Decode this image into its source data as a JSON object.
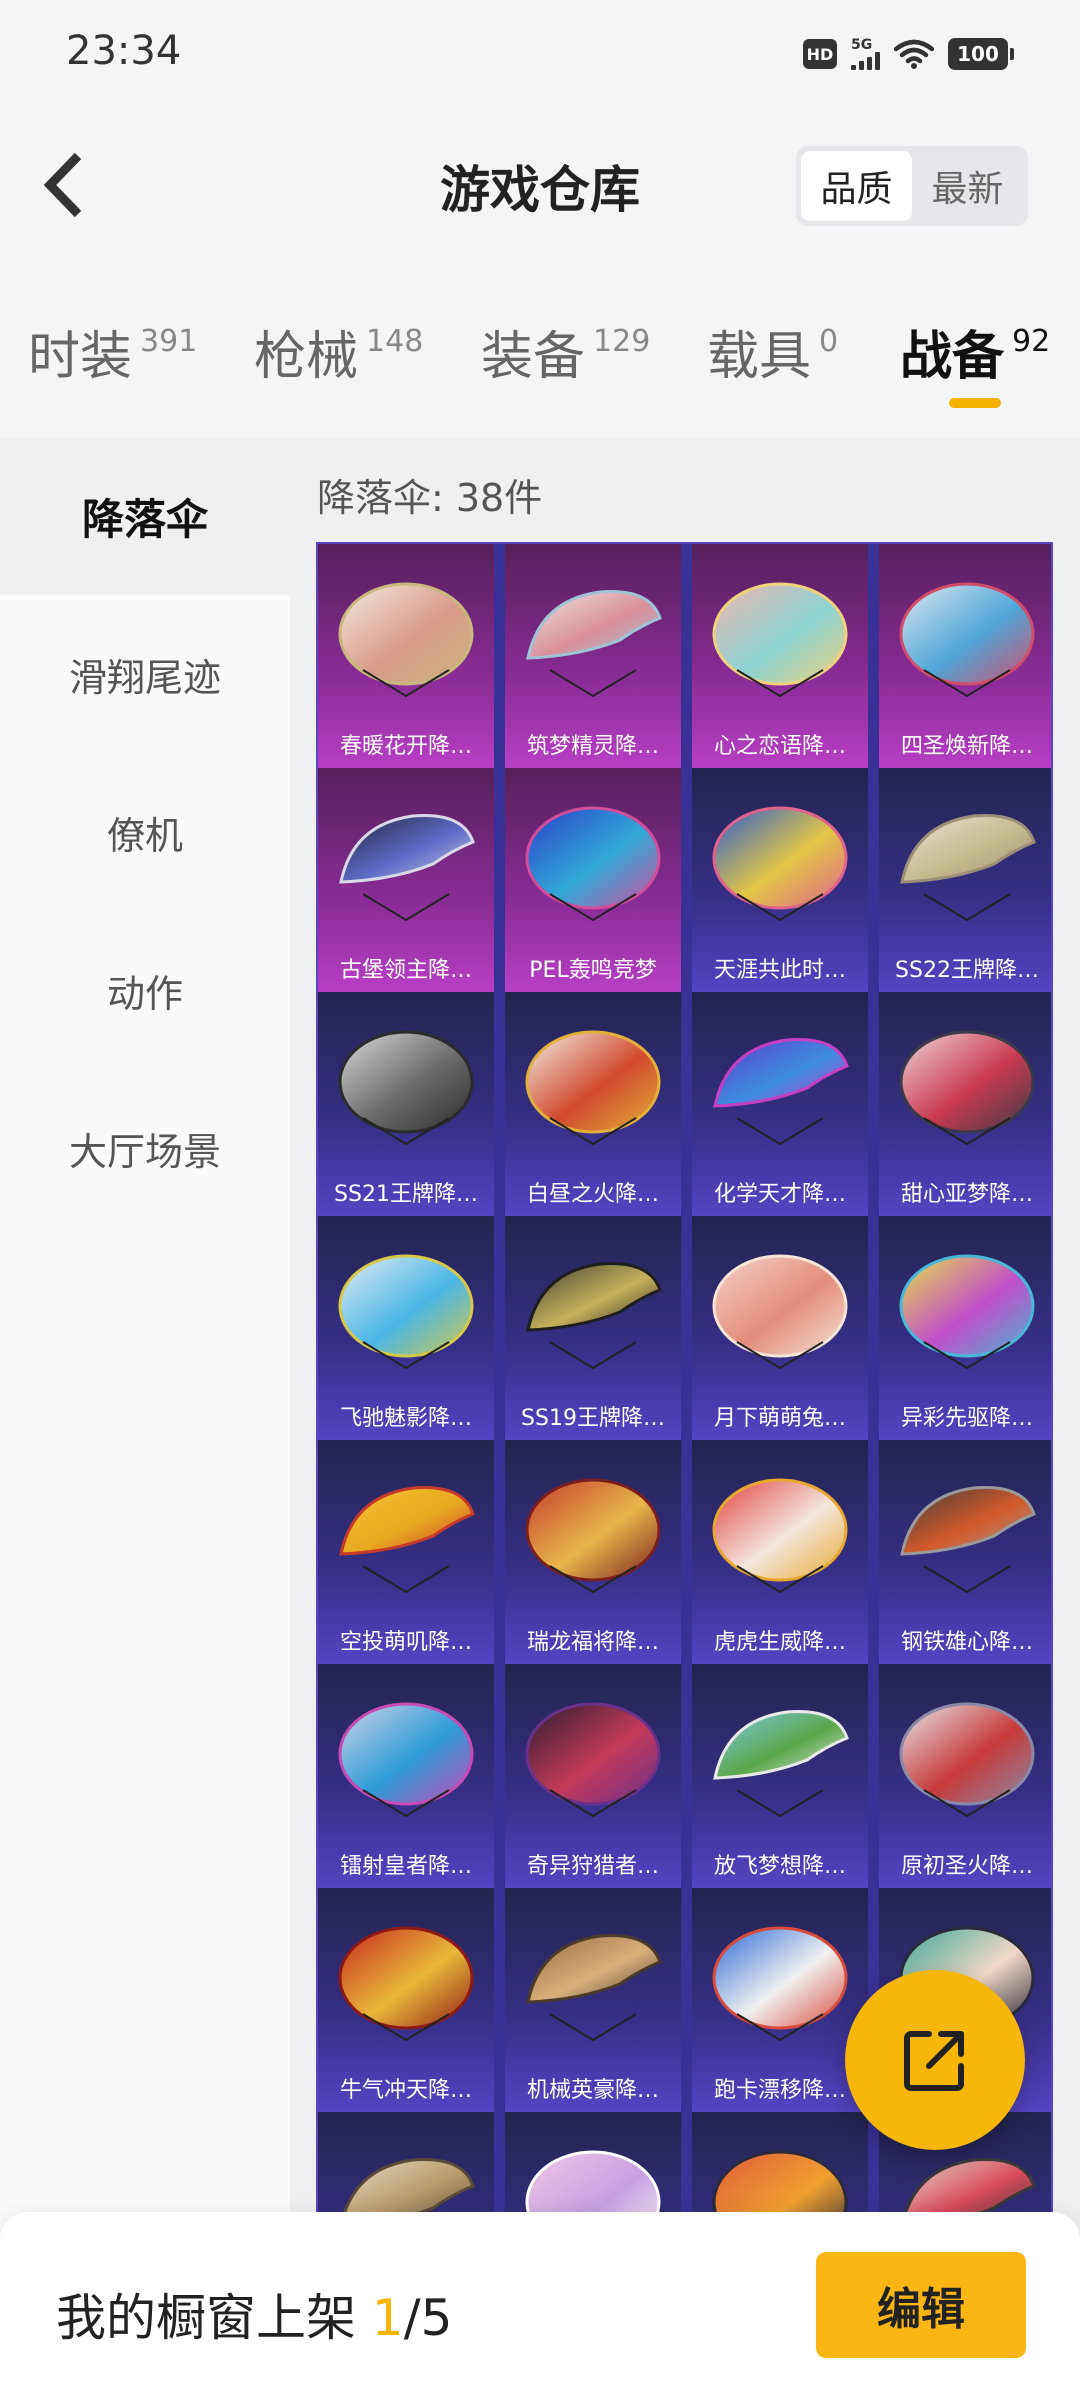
{
  "status_bar": {
    "time": "23:34",
    "hd": "HD",
    "network": "5G",
    "battery": "100"
  },
  "header": {
    "title": "游戏仓库",
    "sort_options": [
      "品质",
      "最新"
    ],
    "sort_selected": "品质"
  },
  "category_tabs": [
    {
      "label": "时装",
      "count": "391"
    },
    {
      "label": "枪械",
      "count": "148"
    },
    {
      "label": "装备",
      "count": "129"
    },
    {
      "label": "载具",
      "count": "0"
    },
    {
      "label": "战备",
      "count": "92",
      "active": true
    }
  ],
  "sidebar": {
    "items": [
      "降落伞",
      "滑翔尾迹",
      "僚机",
      "动作",
      "大厅场景"
    ],
    "selected": "降落伞"
  },
  "content": {
    "count_text": "降落伞: 38件",
    "items": [
      {
        "name": "春暖花开降…",
        "tier": "rare",
        "colors": [
          "#f3ecdf",
          "#d99a8a",
          "#c9b77d"
        ]
      },
      {
        "name": "筑梦精灵降…",
        "tier": "rare",
        "colors": [
          "#efe6e0",
          "#d98f9b",
          "#9fc4d8"
        ]
      },
      {
        "name": "心之恋语降…",
        "tier": "rare",
        "colors": [
          "#f1b7b0",
          "#8bd3d2",
          "#f0d27c"
        ]
      },
      {
        "name": "四圣焕新降…",
        "tier": "rare",
        "colors": [
          "#dfe8ef",
          "#4fa6d8",
          "#d24d6a"
        ]
      },
      {
        "name": "古堡领主降…",
        "tier": "rare",
        "colors": [
          "#23233a",
          "#5c6bc8",
          "#d8d8e8"
        ]
      },
      {
        "name": "PEL轰鸣竞梦",
        "tier": "rare",
        "colors": [
          "#2a3ec8",
          "#31a9d8",
          "#d24d9c"
        ]
      },
      {
        "name": "天涯共此时…",
        "tier": "epic",
        "colors": [
          "#2c5bd0",
          "#e2c646",
          "#e0638c"
        ]
      },
      {
        "name": "SS22王牌降…",
        "tier": "epic",
        "colors": [
          "#e7e2d6",
          "#c7b98e",
          "#9c8f78"
        ]
      },
      {
        "name": "SS21王牌降…",
        "tier": "epic",
        "colors": [
          "#d9d9d9",
          "#6a6a6a",
          "#2b2b2b"
        ]
      },
      {
        "name": "白昼之火降…",
        "tier": "epic",
        "colors": [
          "#f2eee6",
          "#d14a2e",
          "#e3b03a"
        ]
      },
      {
        "name": "化学天才降…",
        "tier": "epic",
        "colors": [
          "#5f3ad1",
          "#3d8de0",
          "#c63ec4"
        ]
      },
      {
        "name": "甜心亚梦降…",
        "tier": "epic",
        "colors": [
          "#f0d6dc",
          "#c93a4f",
          "#3a3a4a"
        ]
      },
      {
        "name": "飞驰魅影降…",
        "tier": "epic",
        "colors": [
          "#e6ecf2",
          "#49b6e6",
          "#d6c94a"
        ]
      },
      {
        "name": "SS19王牌降…",
        "tier": "epic",
        "colors": [
          "#3a3a30",
          "#c7b25a",
          "#1e1e1e"
        ]
      },
      {
        "name": "月下萌萌兔…",
        "tier": "epic",
        "colors": [
          "#f3d2c8",
          "#e48d7c",
          "#f5e5d7"
        ]
      },
      {
        "name": "异彩先驱降…",
        "tier": "epic",
        "colors": [
          "#e8e148",
          "#c04ec8",
          "#49b8d8"
        ]
      },
      {
        "name": "空投萌叽降…",
        "tier": "epic",
        "colors": [
          "#f5c430",
          "#e8a820",
          "#c63a2c"
        ]
      },
      {
        "name": "瑞龙福将降…",
        "tier": "epic",
        "colors": [
          "#c53a2c",
          "#e7b64a",
          "#7a1f1f"
        ]
      },
      {
        "name": "虎虎生威降…",
        "tier": "epic",
        "colors": [
          "#e04242",
          "#f4e6dc",
          "#e8a830"
        ]
      },
      {
        "name": "钢铁雄心降…",
        "tier": "epic",
        "colors": [
          "#3b3b3b",
          "#d45a2a",
          "#9a9a9a"
        ]
      },
      {
        "name": "镭射皇者降…",
        "tier": "epic",
        "colors": [
          "#cfd4e6",
          "#2d9bd8",
          "#c84ab4"
        ]
      },
      {
        "name": "奇异狩猎者…",
        "tier": "epic",
        "colors": [
          "#2a1c2e",
          "#c43a5a",
          "#6b2f8c"
        ]
      },
      {
        "name": "放飞梦想降…",
        "tier": "epic",
        "colors": [
          "#7fc8e8",
          "#5aa84a",
          "#eaeaea"
        ]
      },
      {
        "name": "原初圣火降…",
        "tier": "epic",
        "colors": [
          "#e8e8ec",
          "#c73a3a",
          "#8a8aa8"
        ]
      },
      {
        "name": "牛气冲天降…",
        "tier": "epic",
        "colors": [
          "#c8281f",
          "#e8b83a",
          "#8e1a15"
        ]
      },
      {
        "name": "机械英豪降…",
        "tier": "epic",
        "colors": [
          "#9a6a42",
          "#d7b07a",
          "#4a3a2a"
        ]
      },
      {
        "name": "跑卡漂移降…",
        "tier": "epic",
        "colors": [
          "#2d6ad8",
          "#f0f0f0",
          "#d84a3a"
        ]
      },
      {
        "name": "",
        "tier": "epic",
        "colors": [
          "#3aa89a",
          "#f3d8c6",
          "#2a2a3a"
        ]
      },
      {
        "name": "",
        "tier": "epic",
        "colors": [
          "#e8dcc8",
          "#b89a6a",
          "#5a4a3a"
        ]
      },
      {
        "name": "",
        "tier": "epic",
        "colors": [
          "#f0c8e8",
          "#c8a0e0",
          "#ffffff"
        ]
      },
      {
        "name": "",
        "tier": "epic",
        "colors": [
          "#e05a3a",
          "#f0a030",
          "#2a2a3a"
        ]
      },
      {
        "name": "",
        "tier": "epic",
        "colors": [
          "#e8e0d0",
          "#d84a5a",
          "#3a3a3a"
        ]
      }
    ]
  },
  "fab": {
    "icon": "share-out-icon"
  },
  "bottom_bar": {
    "prefix": "我的橱窗上架 ",
    "current": "1",
    "total": "/5",
    "edit_label": "编辑"
  }
}
